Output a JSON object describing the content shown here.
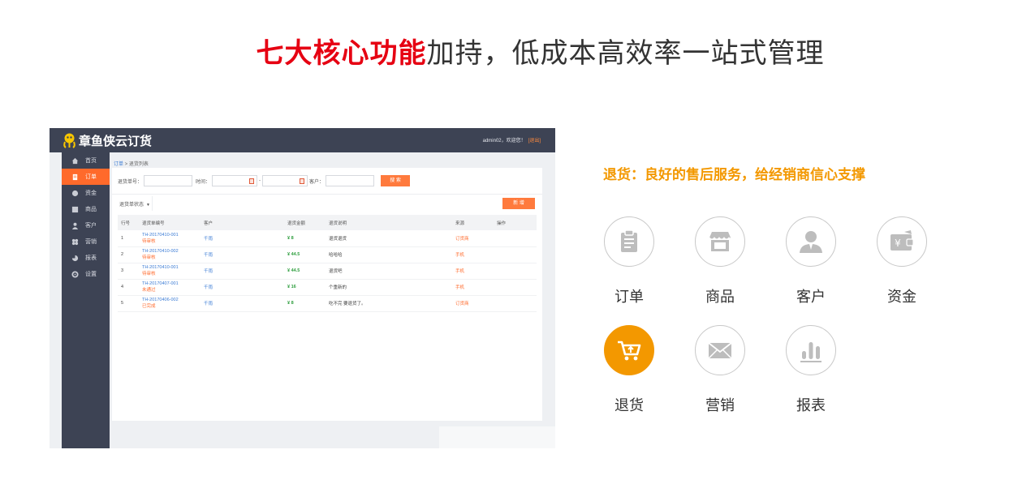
{
  "headline": {
    "highlight": "七大核心功能",
    "rest": "加持，低成本高效率一站式管理"
  },
  "app": {
    "brand": "章鱼侠云订货",
    "user_text": "admin02，欢迎您！",
    "exit": "[退出]",
    "sidebar": [
      {
        "label": "首页",
        "icon": "home-icon"
      },
      {
        "label": "订单",
        "icon": "order-icon",
        "active": true
      },
      {
        "label": "资金",
        "icon": "fund-icon"
      },
      {
        "label": "商品",
        "icon": "goods-icon"
      },
      {
        "label": "客户",
        "icon": "customer-icon"
      },
      {
        "label": "营销",
        "icon": "marketing-icon"
      },
      {
        "label": "报表",
        "icon": "report-icon"
      },
      {
        "label": "设置",
        "icon": "settings-icon"
      }
    ],
    "breadcrumb": {
      "parent": "订单",
      "sep": " > ",
      "current": "退货列表"
    },
    "search": {
      "return_no_label": "退货单号：",
      "time_label": "时间：",
      "to": "-",
      "customer_label": "客户：",
      "search_button": "搜 索"
    },
    "filter_label": "退货单状态",
    "new_button": "新 增",
    "table": {
      "headers": [
        "行号",
        "退货单编号",
        "客户",
        "退货金额",
        "退货说明",
        "来源",
        "操作"
      ],
      "rows": [
        {
          "no": "1",
          "id": "TH-20170410-001",
          "status": "待审核",
          "customer": "千雨",
          "amount": "¥ 8",
          "note": "退货退货",
          "source": "订货商"
        },
        {
          "no": "2",
          "id": "TH-20170410-002",
          "status": "待审核",
          "customer": "千雨",
          "amount": "¥ 44.5",
          "note": "哈哈哈",
          "source": "手机"
        },
        {
          "no": "3",
          "id": "TH-20170410-001",
          "status": "待审核",
          "customer": "千雨",
          "amount": "¥ 44.5",
          "note": "退货吧",
          "source": "手机"
        },
        {
          "no": "4",
          "id": "TH-20170407-001",
          "status": "未通过",
          "customer": "千雨",
          "amount": "¥ 16",
          "note": "个重新的",
          "source": "手机"
        },
        {
          "no": "5",
          "id": "TH-20170406-002",
          "status": "已完成",
          "customer": "千雨",
          "amount": "¥ 8",
          "note": "吃不完 要退货了。",
          "source": "订货商"
        }
      ]
    }
  },
  "feature_desc": "退货：良好的售后服务，给经销商信心支撑",
  "features": [
    {
      "label": "订单",
      "icon": "clipboard-icon"
    },
    {
      "label": "商品",
      "icon": "shop-icon"
    },
    {
      "label": "客户",
      "icon": "person-icon"
    },
    {
      "label": "资金",
      "icon": "wallet-icon"
    },
    {
      "label": "退货",
      "icon": "cart-return-icon",
      "active": true
    },
    {
      "label": "营销",
      "icon": "envelope-icon"
    },
    {
      "label": "报表",
      "icon": "bar-chart-icon"
    }
  ],
  "colors": {
    "highlight": "#e60012",
    "accent": "#f39800",
    "app_dark": "#3d4354",
    "app_orange": "#ff6a2b"
  }
}
